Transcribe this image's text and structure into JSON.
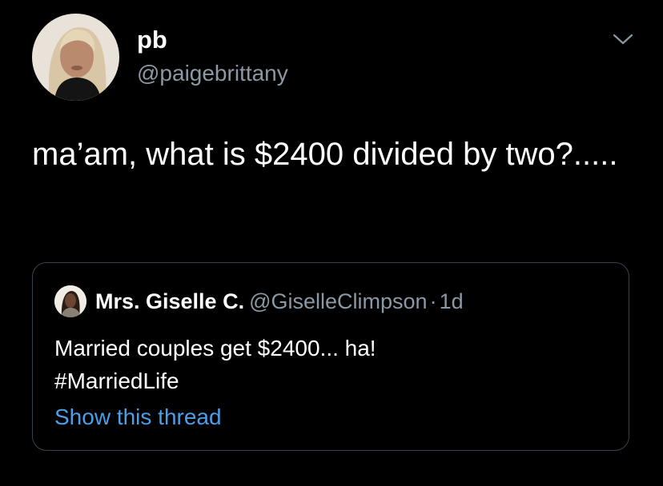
{
  "tweet": {
    "author_name": "pb",
    "author_handle": "@paigebrittany",
    "text": "ma’am, what is $2400 divided by two?....."
  },
  "quoted": {
    "author_name": "Mrs. Giselle C.",
    "author_handle": "@GiselleClimpson",
    "separator": "·",
    "time": "1d",
    "text_line1": "Married couples get $2400... ha!",
    "text_line2": "#MarriedLife",
    "show_thread": "Show this thread"
  },
  "icons": {
    "menu": "chevron-down-icon"
  },
  "colors": {
    "background": "#000000",
    "secondary_text": "#8b98a5",
    "link": "#4a9fe8",
    "card_border": "#38444d"
  }
}
